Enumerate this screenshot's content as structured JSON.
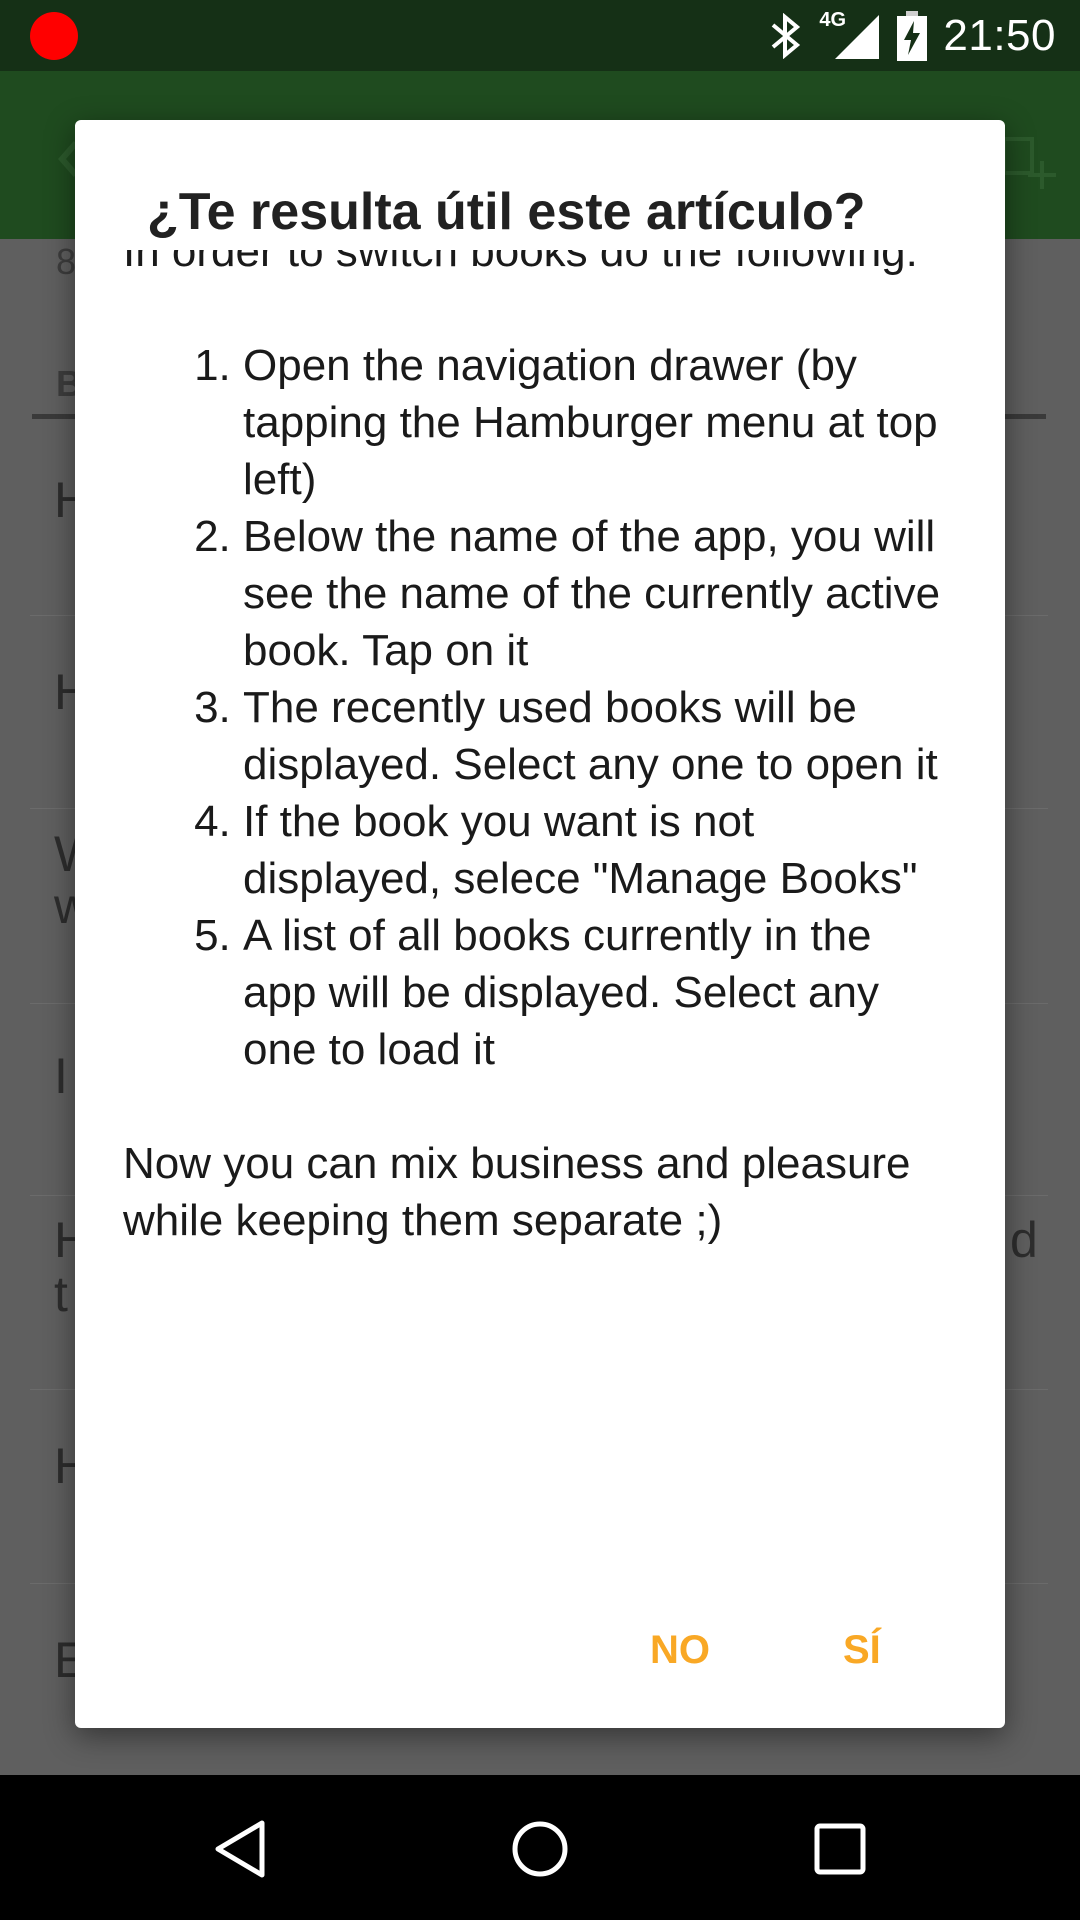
{
  "status_bar": {
    "time": "21:50",
    "network": "4G",
    "icons": [
      "recording-dot-icon",
      "bluetooth-icon",
      "signal-icon",
      "battery-charging-icon"
    ],
    "recording_color": "#ff0000"
  },
  "app": {
    "toolbar_color": "#1f4b1f",
    "background_fragments": [
      "8",
      "B",
      "H",
      "H",
      "W",
      "w",
      "I",
      "H",
      "d",
      "t",
      "H",
      "E"
    ]
  },
  "dialog": {
    "title": "¿Te resulta útil este artículo?",
    "intro_partial": "In order to switch books do the following:",
    "steps": [
      "Open the navigation drawer (by tapping the Hamburger menu at top left)",
      "Below the name of the app, you will see the name of the currently active book. Tap on it",
      "The recently used books will be displayed. Select any one to open it",
      "If the book you want is not displayed, selece \"Manage Books\"",
      "A list of all books currently in the app will be displayed. Select any one to load it"
    ],
    "closing": "Now you can mix business and pleasure while keeping them separate ;)",
    "buttons": {
      "no": "NO",
      "yes": "SÍ"
    },
    "accent_color": "#f9a825"
  },
  "nav_bar": {
    "icons": [
      "back-icon",
      "home-icon",
      "recents-icon"
    ]
  }
}
